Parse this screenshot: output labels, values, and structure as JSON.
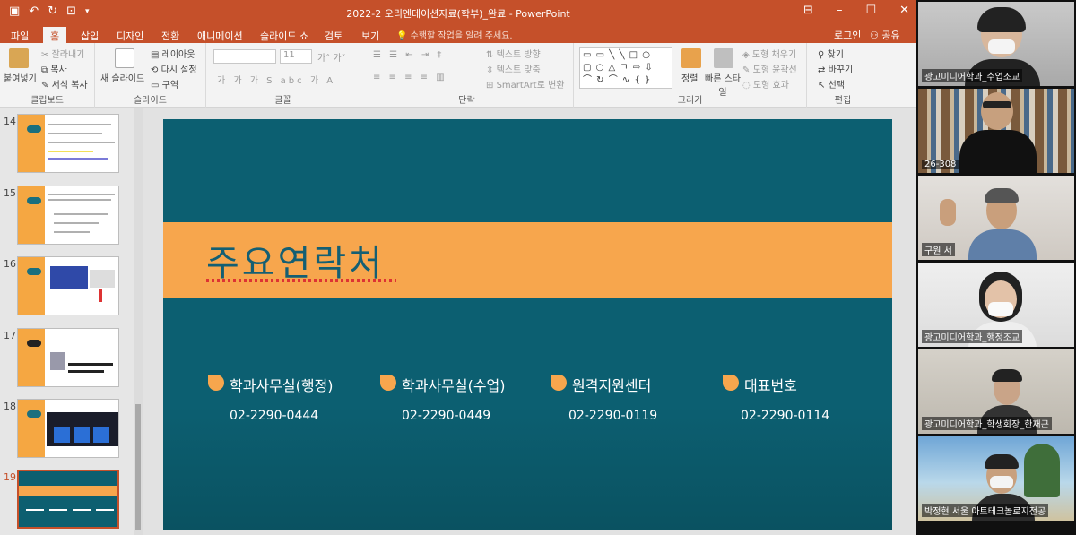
{
  "window": {
    "title": "2022-2 오리엔테이션자료(학부)_완료 - PowerPoint",
    "qat_icons": [
      "save-icon",
      "undo-icon",
      "redo-icon",
      "slideshow-icon",
      "customize-icon"
    ],
    "controls": [
      "ribbon-display-icon",
      "minimize-icon",
      "maximize-icon",
      "close-icon"
    ]
  },
  "tabs": [
    "파일",
    "홈",
    "삽입",
    "디자인",
    "전환",
    "애니메이션",
    "슬라이드 쇼",
    "검토",
    "보기"
  ],
  "active_tab": "홈",
  "tell_me": "수행할 작업을 알려 주세요.",
  "login": "로그인",
  "share": "공유",
  "ribbon": {
    "clipboard": {
      "paste": "붙여넣기",
      "cut": "잘라내기",
      "copy": "복사",
      "format_painter": "서식 복사",
      "group": "클립보드"
    },
    "slides": {
      "new_slide": "새 슬라이드",
      "layout": "레이아웃",
      "reset": "다시 설정",
      "section": "구역",
      "group": "슬라이드"
    },
    "font": {
      "size": "11",
      "group": "글꼴"
    },
    "paragraph": {
      "text_direction": "텍스트 방향",
      "align_text": "텍스트 맞춤",
      "smartart": "SmartArt로 변환",
      "group": "단락"
    },
    "drawing": {
      "arrange": "정렬",
      "quick_styles": "빠른 스타일",
      "fill": "도형 채우기",
      "outline": "도형 윤곽선",
      "effects": "도형 효과",
      "group": "그리기"
    },
    "editing": {
      "find": "찾기",
      "replace": "바꾸기",
      "select": "선택",
      "group": "편집"
    }
  },
  "thumbnails": [
    {
      "num": "14",
      "selected": false
    },
    {
      "num": "15",
      "selected": false
    },
    {
      "num": "16",
      "selected": false
    },
    {
      "num": "17",
      "selected": false
    },
    {
      "num": "18",
      "selected": false
    },
    {
      "num": "19",
      "selected": true
    }
  ],
  "slide": {
    "title": "주요연락처",
    "contacts": [
      {
        "label": "학과사무실(행정)",
        "phone": "02-2290-0444"
      },
      {
        "label": "학과사무실(수업)",
        "phone": "02-2290-0449"
      },
      {
        "label": "원격지원센터",
        "phone": "02-2290-0119"
      },
      {
        "label": "대표번호",
        "phone": "02-2290-0114"
      }
    ]
  },
  "participants": [
    {
      "name": "광고미디어학과_수업조교"
    },
    {
      "name": "26-308"
    },
    {
      "name": "구원 서"
    },
    {
      "name": "광고미디어학과_행정조교"
    },
    {
      "name": "광고미디어학과_학생회장_한재근"
    },
    {
      "name": "박정현 서울 아트테크놀로지전공"
    }
  ],
  "colors": {
    "accent": "#c5502a",
    "slide_bg": "#0c5f71",
    "slide_band": "#f7a64d",
    "title_text": "#145f73"
  }
}
